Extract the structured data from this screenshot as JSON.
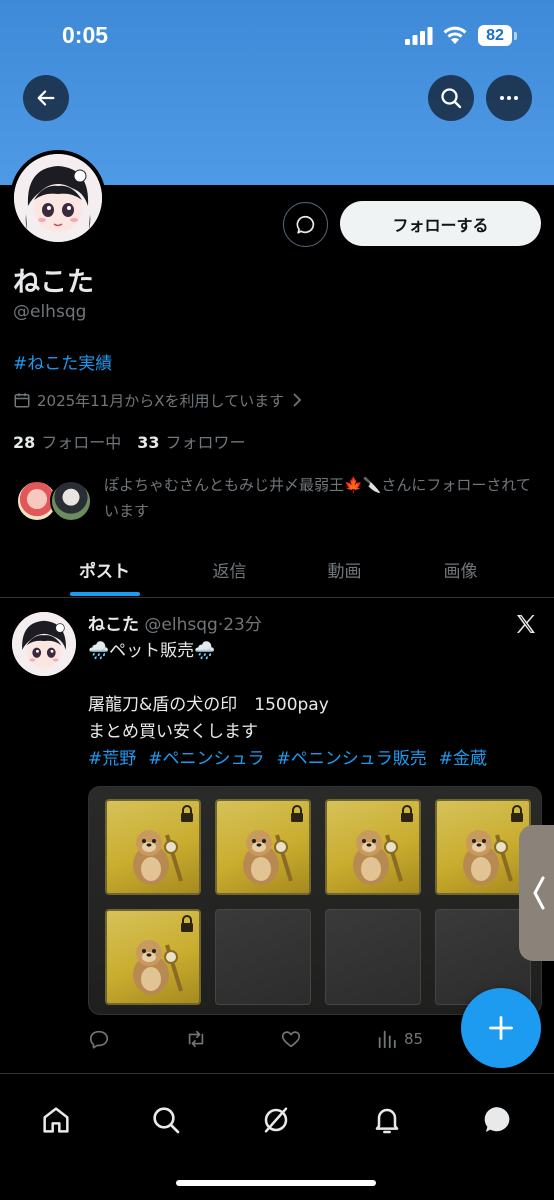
{
  "status_bar": {
    "time": "0:05",
    "battery_level": "82"
  },
  "profile": {
    "display_name": "ねこた",
    "handle": "@elhsqg",
    "bio_hashtag": "#ねこた実績",
    "joined_text": "2025年11月からXを利用しています",
    "following_count": "28",
    "following_label": "フォロー中",
    "followers_count": "33",
    "followers_label": "フォロワー",
    "followed_by_text": "ぽよちゃむさんともみじ井〆最弱王🍁🔪さんにフォローされています",
    "follow_button_label": "フォローする"
  },
  "tabs": [
    {
      "label": "ポスト",
      "active": true
    },
    {
      "label": "返信",
      "active": false
    },
    {
      "label": "動画",
      "active": false
    },
    {
      "label": "画像",
      "active": false
    }
  ],
  "post": {
    "author_name": "ねこた",
    "author_handle": "@elhsqg",
    "separator": "·",
    "time_ago": "23分",
    "line1": "🌧️ペット販売🌧️",
    "line2": "",
    "line3": "屠龍刀&盾の犬の印　1500pay",
    "line4": "まとめ買い安くします",
    "hashtags": [
      "#荒野",
      "#ペニンシュラ",
      "#ペニンシュラ販売",
      "#金蔵"
    ],
    "views_count": "85",
    "media_filled_slots": 5,
    "media_total_slots": 8
  },
  "icons": {
    "back": "arrow-left-icon",
    "search": "search-icon",
    "more": "more-horizontal-icon",
    "message": "message-bubble-icon",
    "calendar": "calendar-icon",
    "x_logo": "x-logo-icon",
    "reply": "reply-icon",
    "repost": "repost-icon",
    "like": "heart-icon",
    "views": "views-bar-icon",
    "compose": "plus-icon",
    "nav": [
      "home-icon",
      "search-icon",
      "grok-icon",
      "bell-icon",
      "messages-icon"
    ]
  },
  "colors": {
    "banner": "#4f9ae6",
    "accent": "#1d9bf0",
    "background": "#000000",
    "secondary_text": "#71767b"
  }
}
